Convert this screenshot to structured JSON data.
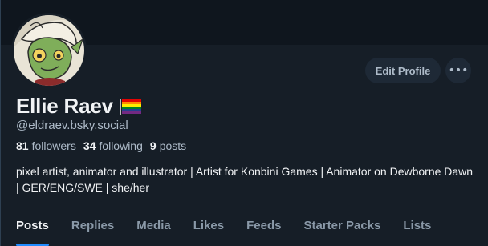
{
  "profile": {
    "display_name": "Ellie Raev",
    "handle": "@eldraev.bsky.social",
    "flag_icon": "rainbow-flag-icon",
    "avatar_icon": "avatar-image"
  },
  "actions": {
    "edit_profile_label": "Edit Profile",
    "more_label": "•••"
  },
  "stats": {
    "followers_count": "81",
    "followers_label": "followers",
    "following_count": "34",
    "following_label": "following",
    "posts_count": "9",
    "posts_label": "posts"
  },
  "bio": "pixel artist, animator and illustrator | Artist for Konbini Games | Animator on Dewborne Dawn | GER/ENG/SWE | she/her",
  "tabs": [
    {
      "label": "Posts",
      "active": true
    },
    {
      "label": "Replies",
      "active": false
    },
    {
      "label": "Media",
      "active": false
    },
    {
      "label": "Likes",
      "active": false
    },
    {
      "label": "Feeds",
      "active": false
    },
    {
      "label": "Starter Packs",
      "active": false
    },
    {
      "label": "Lists",
      "active": false
    }
  ],
  "colors": {
    "background": "#161e27",
    "accent": "#208bfe",
    "text_primary": "#f1f3f5",
    "text_secondary": "#aebbc9"
  }
}
